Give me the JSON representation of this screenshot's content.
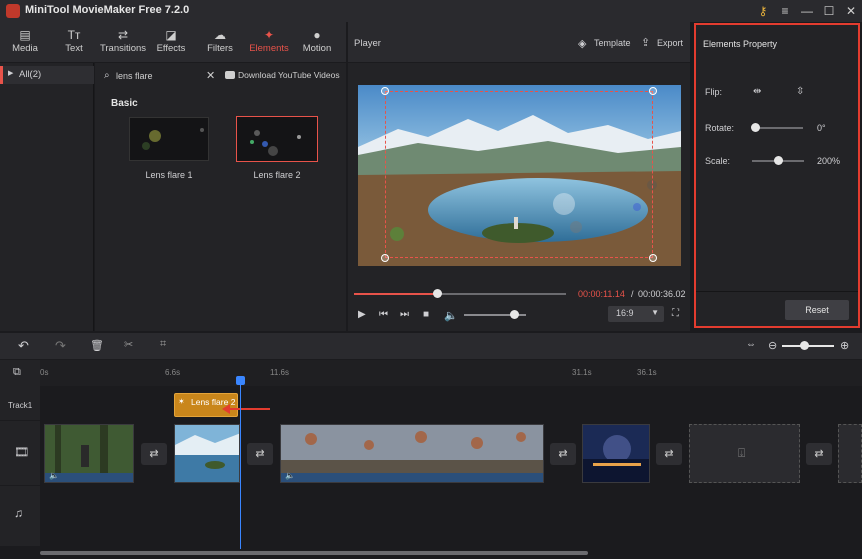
{
  "app": {
    "title": "MiniTool MovieMaker Free 7.2.0"
  },
  "window_controls": {
    "key": "⚷",
    "menu": "≡",
    "minimize": "—",
    "maximize": "☐",
    "close": "✕"
  },
  "toolbar": [
    {
      "label": "Media",
      "icon": "folder-icon",
      "glyph": "▤"
    },
    {
      "label": "Text",
      "icon": "text-icon",
      "glyph": "Tт"
    },
    {
      "label": "Transitions",
      "icon": "transitions-icon",
      "glyph": "⇄"
    },
    {
      "label": "Effects",
      "icon": "effects-icon",
      "glyph": "◪"
    },
    {
      "label": "Filters",
      "icon": "filters-icon",
      "glyph": "☁"
    },
    {
      "label": "Elements",
      "icon": "elements-icon",
      "glyph": "✦"
    },
    {
      "label": "Motion",
      "icon": "motion-icon",
      "glyph": "●"
    }
  ],
  "sidebar": {
    "all_label": "All(2)"
  },
  "library": {
    "search_value": "lens flare",
    "youtube_label": "Download YouTube Videos",
    "section": "Basic",
    "items": [
      {
        "label": "Lens flare 1"
      },
      {
        "label": "Lens flare 2"
      }
    ]
  },
  "player": {
    "title": "Player",
    "template_label": "Template",
    "export_label": "Export",
    "current_time": "00:00:11.14",
    "separator": "/",
    "total_time": "00:00:36.02",
    "aspect": "16:9",
    "progress": 0.39,
    "volume": 0.8
  },
  "properties": {
    "title": "Elements Property",
    "flip_label": "Flip:",
    "rotate_label": "Rotate:",
    "rotate_value": "0°",
    "scale_label": "Scale:",
    "scale_value": "200%",
    "reset_label": "Reset"
  },
  "timeline": {
    "ruler": [
      "0s",
      "6.6s",
      "11.6s",
      "31.1s",
      "36.1s"
    ],
    "track1_label": "Track1",
    "element_clip_label": "Lens flare 2"
  },
  "colors": {
    "accent": "#e8534a",
    "playhead": "#3a86ff",
    "element_clip": "#c9861b"
  }
}
